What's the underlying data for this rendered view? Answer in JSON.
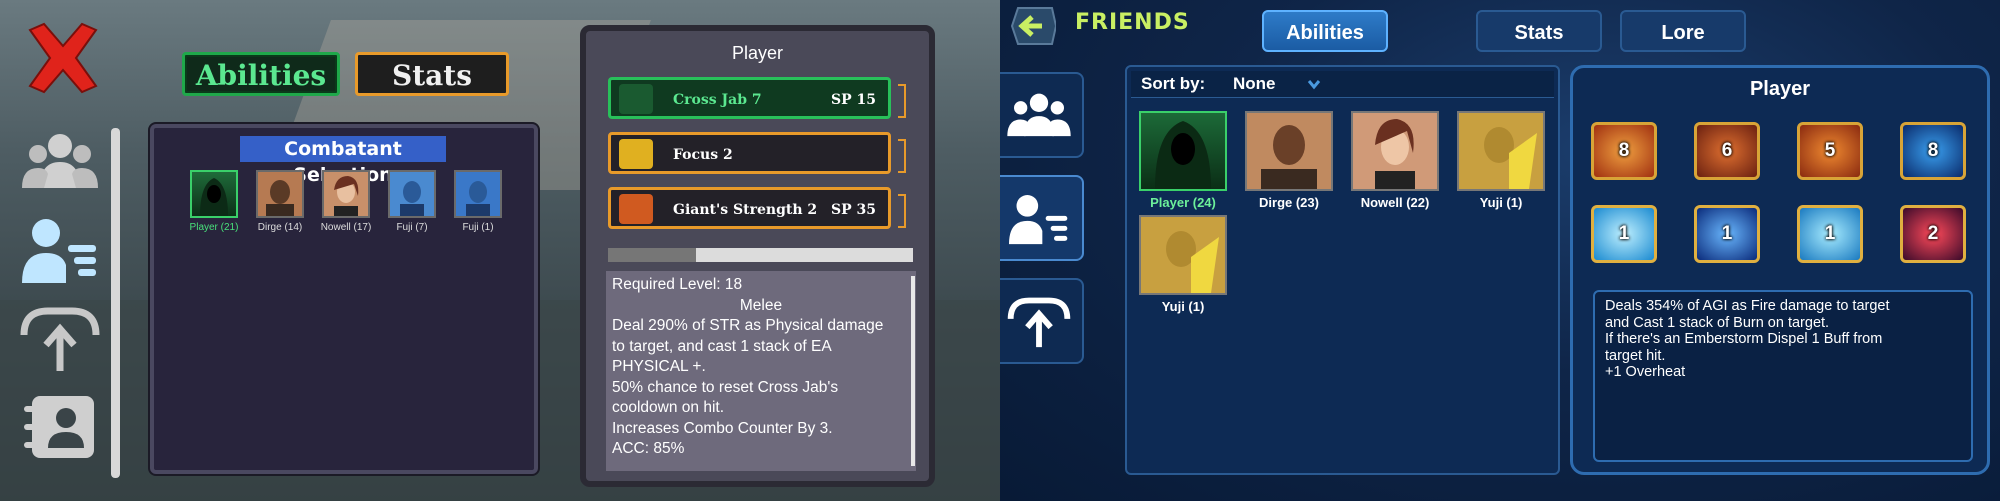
{
  "old_ui": {
    "tabs": {
      "abilities": "Abilities",
      "stats": "Stats"
    },
    "combatant_panel": {
      "title": "Combatant Selection",
      "members": [
        {
          "label": "Player (21)",
          "selected": true
        },
        {
          "label": "Dirge (14)"
        },
        {
          "label": "Nowell (17)"
        },
        {
          "label": "Fuji (7)"
        },
        {
          "label": "Fuji (1)"
        }
      ]
    },
    "player_panel": {
      "title": "Player",
      "abilities": [
        {
          "name": "Cross Jab 7",
          "cost": "SP 15",
          "selected": true
        },
        {
          "name": "Focus 2",
          "cost": ""
        },
        {
          "name": "Giant's Strength 2",
          "cost": "SP 35"
        }
      ],
      "progress": 0.29,
      "description": [
        "Required Level: 18",
        "Melee",
        "Deal 290% of STR as Physical damage",
        "to target, and cast 1 stack of EA",
        "PHYSICAL +.",
        "50% chance to reset Cross Jab's",
        "cooldown on hit.",
        "Increases Combo Counter By 3.",
        "ACC: 85%"
      ]
    },
    "side_icons": [
      "party-icon",
      "character-list-icon",
      "upload-icon",
      "contacts-book-icon"
    ]
  },
  "new_ui": {
    "title": "FRIENDS",
    "tabs": {
      "abilities": "Abilities",
      "stats": "Stats",
      "lore": "Lore"
    },
    "sort": {
      "label": "Sort by:",
      "value": "None"
    },
    "friends": [
      {
        "label": "Player (24)",
        "selected": true
      },
      {
        "label": "Dirge (23)"
      },
      {
        "label": "Nowell (22)"
      },
      {
        "label": "Yuji (1)"
      },
      {
        "label": "Yuji (1)"
      }
    ],
    "player_panel": {
      "title": "Player",
      "slots": [
        "8",
        "6",
        "5",
        "8",
        "1",
        "1",
        "1",
        "2"
      ],
      "description": [
        "Deals 354% of AGI as Fire damage to target",
        "and Cast 1 stack of Burn on target.",
        "If there's an Emberstorm Dispel 1 Buff from",
        "target hit.",
        "+1 Overheat"
      ]
    },
    "side_icons": [
      "party-icon",
      "character-list-icon",
      "upload-icon"
    ],
    "colors": {
      "accent": "#c9ef63",
      "tab_active": "#2e7bc8",
      "panel_border": "#2e6cb0"
    }
  }
}
